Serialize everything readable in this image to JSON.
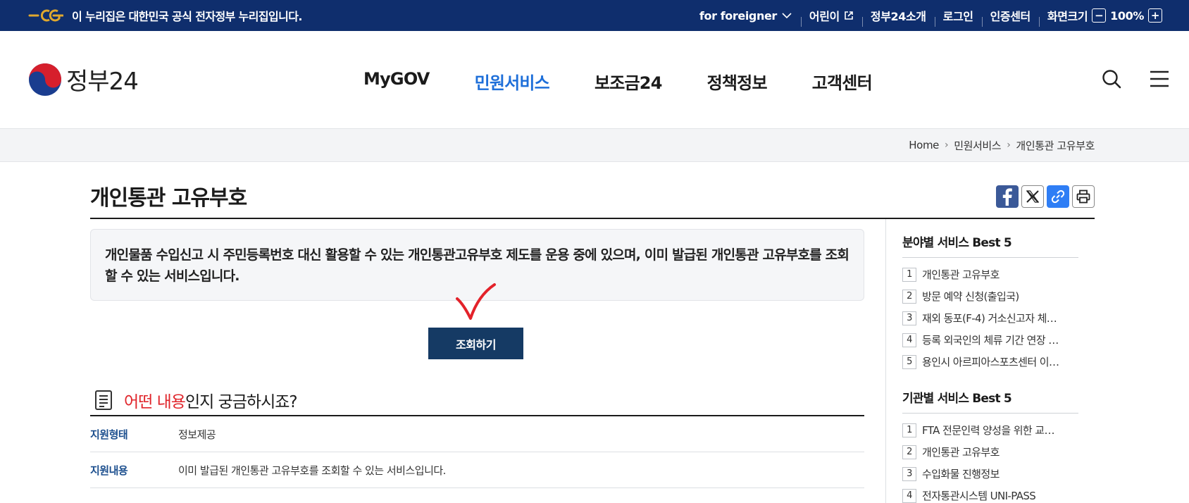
{
  "govbar": {
    "notice": "이 누리집은 대한민국 공식 전자정부 누리집입니다.",
    "links": [
      {
        "label": "for foreigner",
        "icon": "chevron-down-icon"
      },
      {
        "label": "어린이",
        "icon": "external-link-icon"
      },
      {
        "label": "정부24소개"
      },
      {
        "label": "로그인"
      },
      {
        "label": "인증센터"
      }
    ],
    "zoom": {
      "label": "화면크기",
      "value": "100%",
      "minus": "−",
      "plus": "+"
    }
  },
  "header": {
    "logo_text": "정부24",
    "menus": [
      "MyGOV",
      "민원서비스",
      "보조금24",
      "정책정보",
      "고객센터"
    ],
    "active_menu": "민원서비스"
  },
  "breadcrumb": [
    "Home",
    "민원서비스",
    "개인통관 고유부호"
  ],
  "page": {
    "title": "개인통관 고유부호",
    "intro": "개인물품 수입신고 시 주민등록번호 대신 활용할 수 있는 개인통관고유부호 제도를 운용 중에 있으며, 이미 발급된 개인통관 고유부호를 조회할 수 있는 서비스입니다.",
    "action_button": "조회하기",
    "section_title_highlight": "어떤 내용",
    "section_title_rest": "인지 궁금하시죠?",
    "info": [
      {
        "key": "지원형태",
        "value": "정보제공"
      },
      {
        "key": "지원내용",
        "value": "이미 발급된 개인통관 고유부호를 조회할 수 있는 서비스입니다."
      }
    ]
  },
  "sidebar": {
    "best_by_field": {
      "title": "분야별 서비스 Best 5",
      "items": [
        {
          "num": "1",
          "label": "개인통관 고유부호"
        },
        {
          "num": "2",
          "label": "방문 예약 신청(출입국)"
        },
        {
          "num": "3",
          "label": "재외 동포(F-4) 거소신고자 체…"
        },
        {
          "num": "4",
          "label": "등록 외국인의 체류 기간 연장 …"
        },
        {
          "num": "5",
          "label": "용인시 아르피아스포츠센터 이…"
        }
      ]
    },
    "best_by_agency": {
      "title": "기관별 서비스 Best 5",
      "items": [
        {
          "num": "1",
          "label": "FTA 전문인력 양성을 위한 교…"
        },
        {
          "num": "2",
          "label": "개인통관 고유부호"
        },
        {
          "num": "3",
          "label": "수입화물 진행정보"
        },
        {
          "num": "4",
          "label": "전자통관시스템 UNI-PASS"
        }
      ]
    }
  },
  "colors": {
    "govbar": "#0f2e6d",
    "active_menu": "#1e6fd9",
    "button": "#153a64",
    "highlight": "#e0252b",
    "check_mark": "#e3222a"
  }
}
